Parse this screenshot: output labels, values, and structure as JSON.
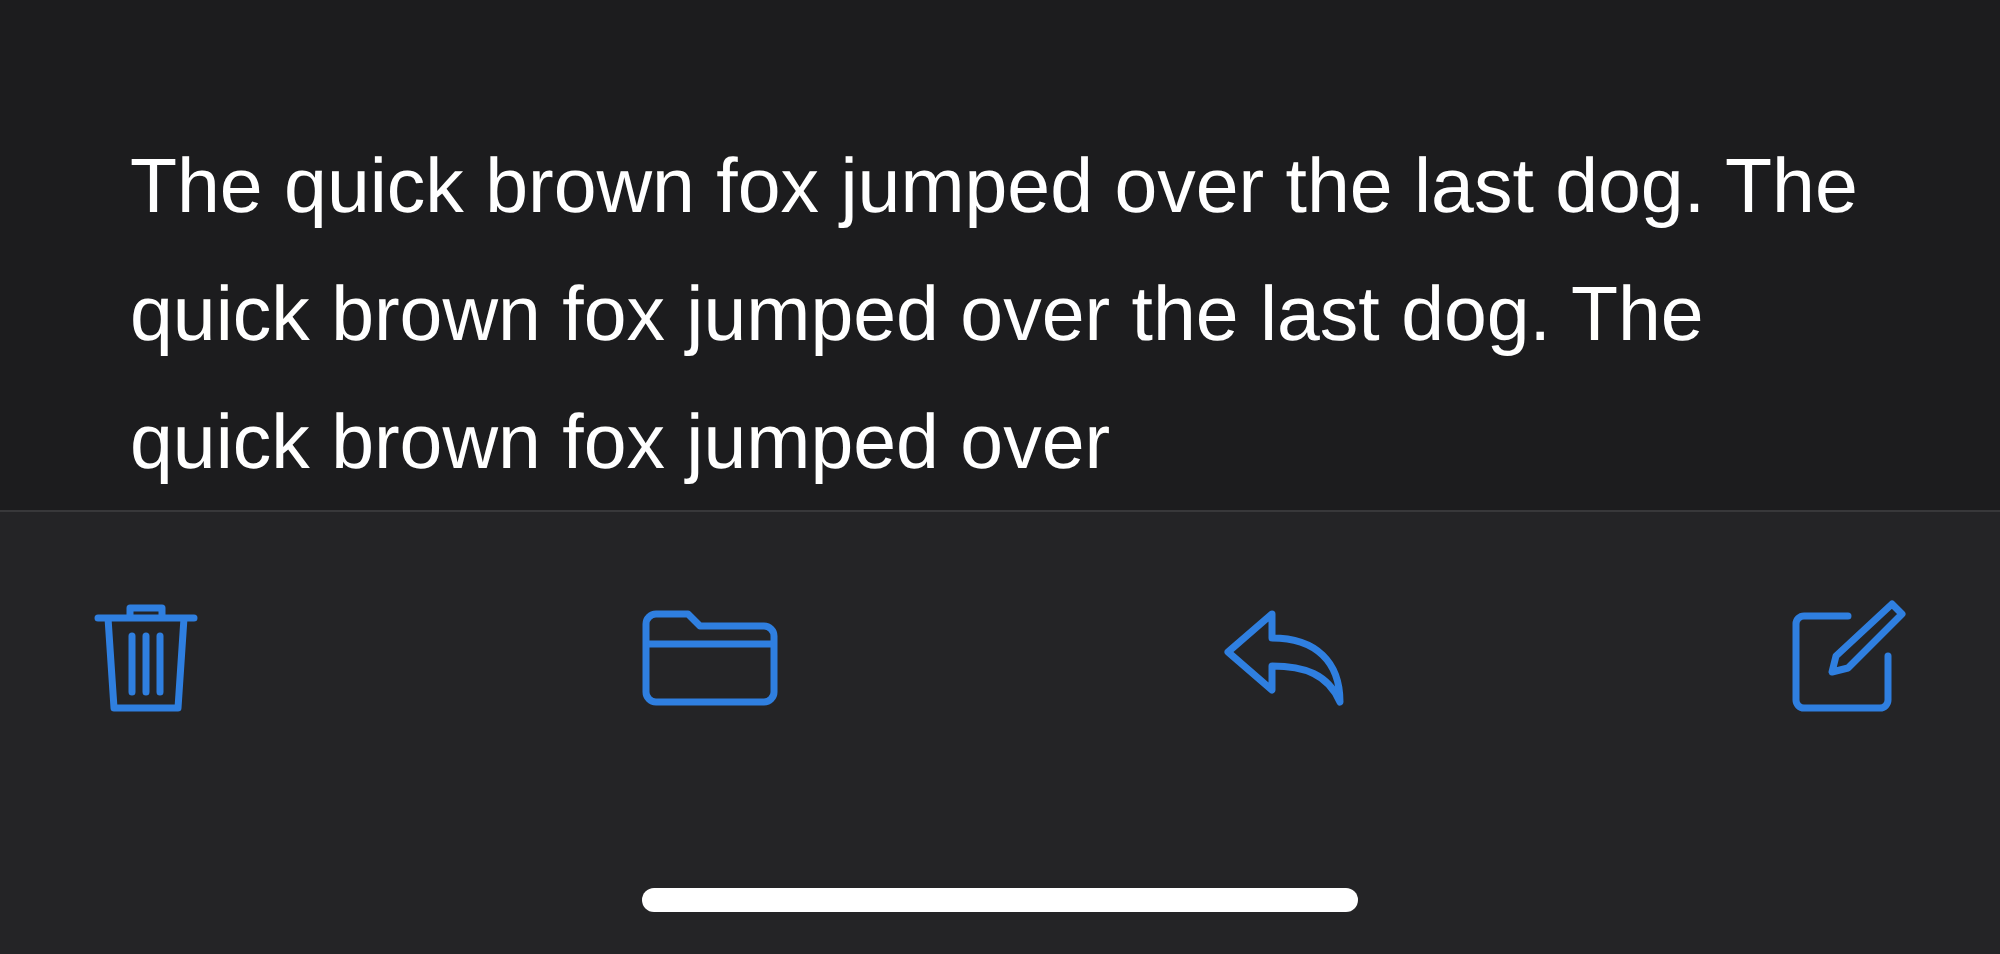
{
  "message": {
    "body": "The quick brown fox jumped over the last dog. The quick brown fox jumped over the last dog. The quick brown fox jumped over"
  },
  "toolbar": {
    "buttons": [
      {
        "kind": "trash"
      },
      {
        "kind": "folder"
      },
      {
        "kind": "reply"
      },
      {
        "kind": "compose"
      }
    ]
  }
}
